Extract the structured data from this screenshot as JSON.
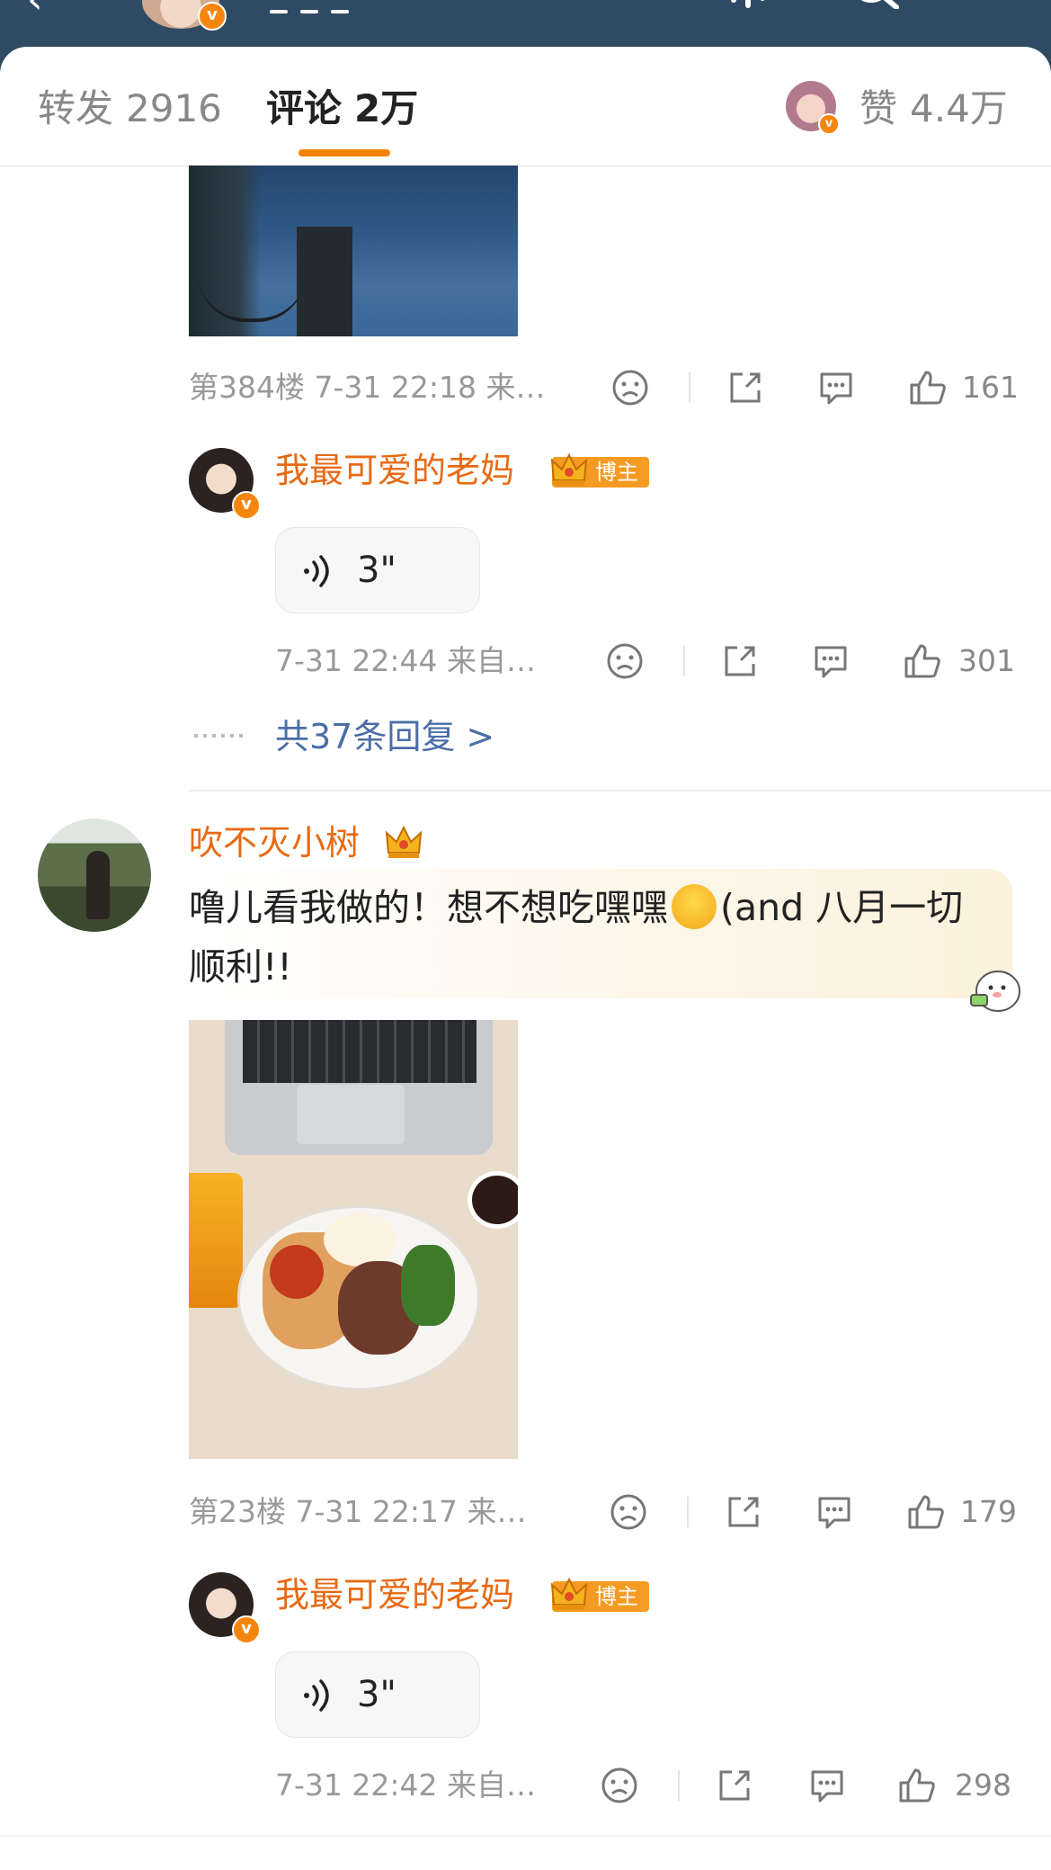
{
  "header": {
    "tabs": {
      "repost_label": "转发",
      "repost_count": "2916",
      "comments_label": "评论",
      "comments_count": "2万",
      "likes_label": "赞",
      "likes_count": "4.4万"
    }
  },
  "comments": [
    {
      "floor_meta": "第384楼 7-31 22:18 来…",
      "likes": "161",
      "reply": {
        "author": "我最可爱的老妈",
        "badge": "博主",
        "voice_duration": "3\"",
        "meta": "7-31 22:44 来自…",
        "likes": "301"
      },
      "more_replies": "共37条回复 >"
    },
    {
      "author": "吹不灭小树",
      "text_part1": "噜儿看我做的！想不想吃嘿嘿",
      "text_part2": "(and 八月一切顺利!!",
      "floor_meta": "第23楼 7-31 22:17 来…",
      "likes": "179",
      "reply": {
        "author": "我最可爱的老妈",
        "badge": "博主",
        "voice_duration": "3\"",
        "meta": "7-31 22:42 来自…",
        "likes": "298"
      }
    }
  ],
  "colors": {
    "accent": "#f7820b",
    "name_orange": "#e86a14",
    "link_blue": "#4b6ea6",
    "header_bg": "#2f4b63"
  }
}
